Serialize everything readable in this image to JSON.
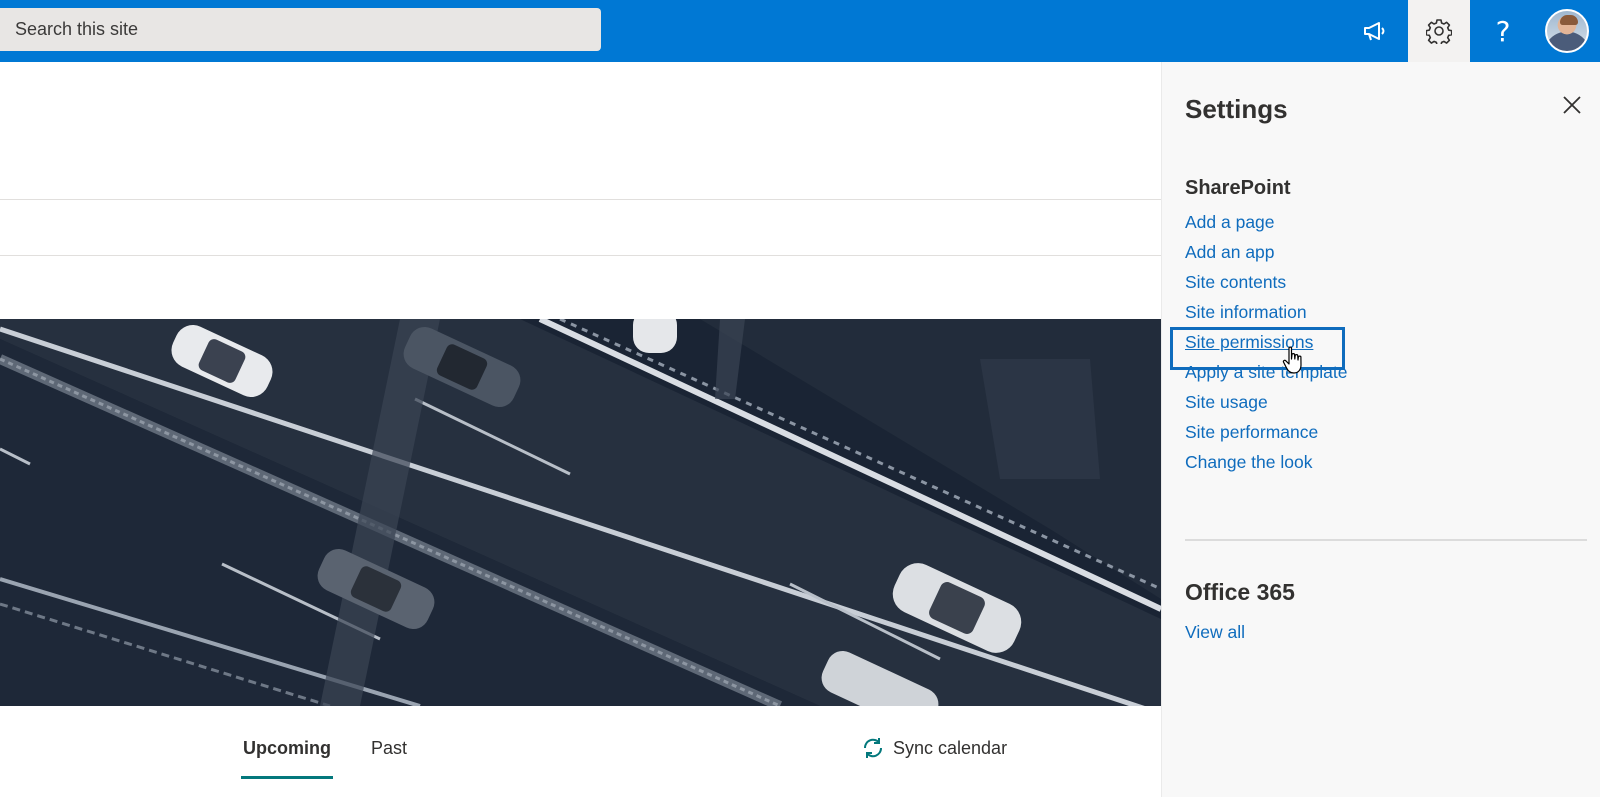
{
  "topbar": {
    "search_placeholder": "Search this site",
    "help_label": "?",
    "icons": {
      "announce": "megaphone-icon",
      "settings": "gear-icon",
      "help": "question-icon",
      "avatar": "user-avatar"
    },
    "brand_color": "#0078d4"
  },
  "main": {
    "tabs": [
      {
        "label": "Upcoming",
        "selected": true
      },
      {
        "label": "Past",
        "selected": false
      }
    ],
    "sync_label": "Sync calendar",
    "accent_color": "#03787c"
  },
  "settings": {
    "title": "Settings",
    "sharepoint": {
      "heading": "SharePoint",
      "links": [
        {
          "label": "Add a page"
        },
        {
          "label": "Add an app"
        },
        {
          "label": "Site contents"
        },
        {
          "label": "Site information"
        },
        {
          "label": "Site permissions",
          "hovered": true
        },
        {
          "label": "Apply a site template"
        },
        {
          "label": "Site usage"
        },
        {
          "label": "Site performance"
        },
        {
          "label": "Change the look"
        }
      ]
    },
    "office365": {
      "heading": "Office 365",
      "view_all_label": "View all"
    },
    "link_color": "#0f6cbd"
  }
}
